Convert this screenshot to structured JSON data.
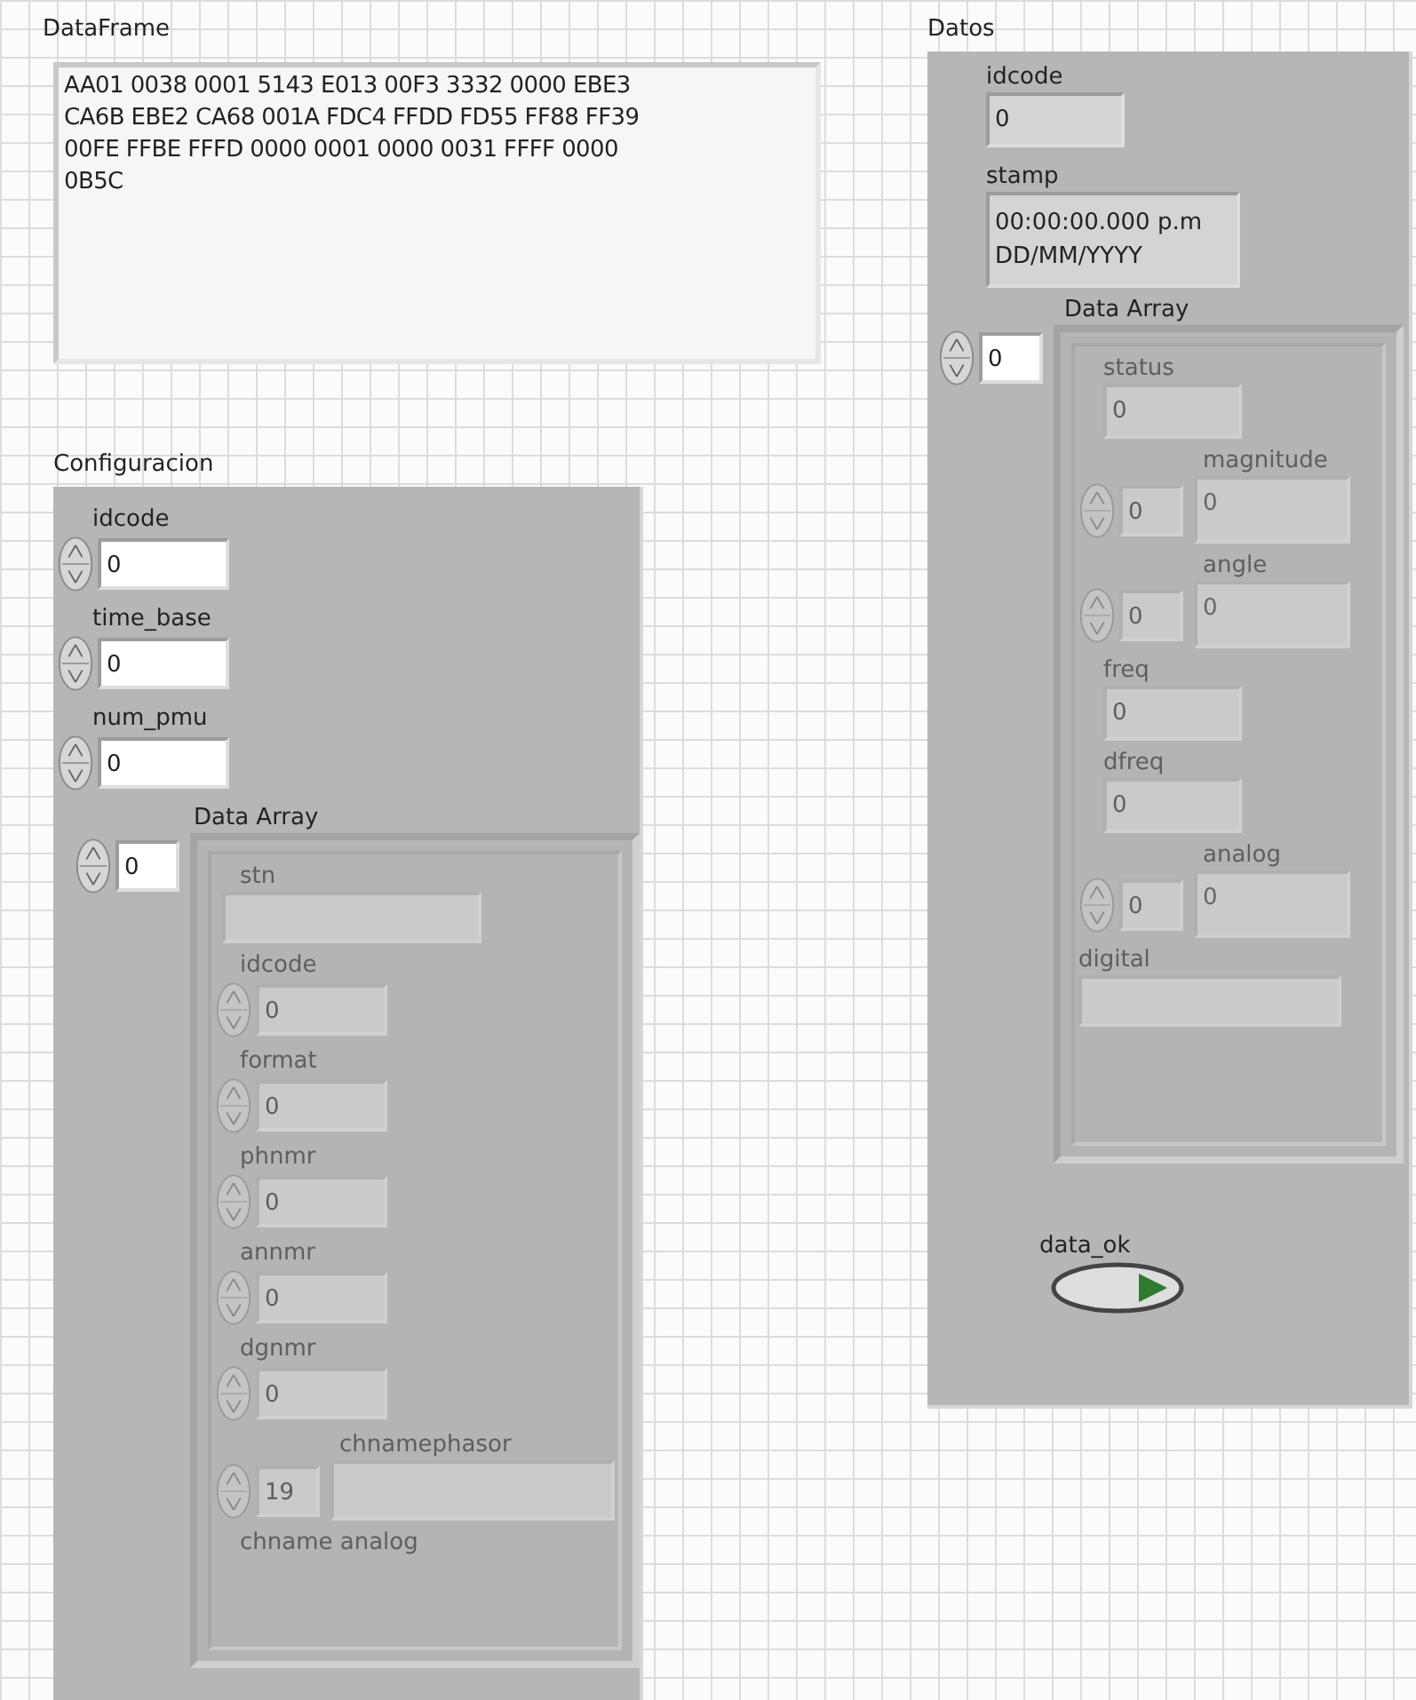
{
  "dataframe": {
    "label": "DataFrame",
    "lines": [
      "AA01 0038 0001 5143 E013 00F3 3332 0000 EBE3",
      "CA6B EBE2 CA68 001A FDC4 FFDD FD55 FF88 FF39",
      "00FE FFBE FFFD 0000 0001 0000 0031 FFFF 0000",
      "0B5C"
    ]
  },
  "clusters": [
    {
      "label": "Configuracion",
      "items": [
        {
          "kind": "numeric",
          "label": "idcode",
          "value": "0"
        },
        {
          "kind": "numeric",
          "label": "time_base",
          "value": "0"
        },
        {
          "kind": "numeric",
          "label": "num_pmu",
          "value": "0"
        }
      ],
      "data_array": {
        "label": "Data Array",
        "index": "0",
        "disabled": true,
        "items": [
          {
            "kind": "string",
            "label": "stn"
          },
          {
            "kind": "numeric",
            "label": "idcode",
            "value": "0"
          },
          {
            "kind": "numeric",
            "label": "format",
            "value": "0"
          },
          {
            "kind": "numeric",
            "label": "phnmr",
            "value": "0"
          },
          {
            "kind": "numeric",
            "label": "annmr",
            "value": "0"
          },
          {
            "kind": "numeric",
            "label": "dgnmr",
            "value": "0"
          },
          {
            "kind": "array",
            "label": "chnamephasor",
            "index": "19"
          },
          {
            "kind": "caption",
            "label": "chname analog"
          }
        ]
      }
    },
    {
      "label": "Datos",
      "items": [
        {
          "kind": "indicator",
          "label": "idcode",
          "lines": [
            "0"
          ]
        },
        {
          "kind": "indicator",
          "label": "stamp",
          "lines": [
            "00:00:00.000 p.m",
            "DD/MM/YYYY"
          ]
        }
      ],
      "data_array": {
        "label": "Data Array",
        "index": "0",
        "disabled": true,
        "items": [
          {
            "kind": "indicator",
            "label": "status",
            "lines": [
              "0"
            ]
          },
          {
            "kind": "array",
            "label": "magnitude",
            "index": "0",
            "value": "0"
          },
          {
            "kind": "array",
            "label": "angle",
            "index": "0",
            "value": "0"
          },
          {
            "kind": "indicator",
            "label": "freq",
            "lines": [
              "0"
            ]
          },
          {
            "kind": "indicator",
            "label": "dfreq",
            "lines": [
              "0"
            ]
          },
          {
            "kind": "array",
            "label": "analog",
            "index": "0",
            "value": "0"
          },
          {
            "kind": "string",
            "label": "digital"
          }
        ]
      },
      "footer": [
        {
          "kind": "boolean",
          "label": "data_ok"
        }
      ]
    }
  ]
}
